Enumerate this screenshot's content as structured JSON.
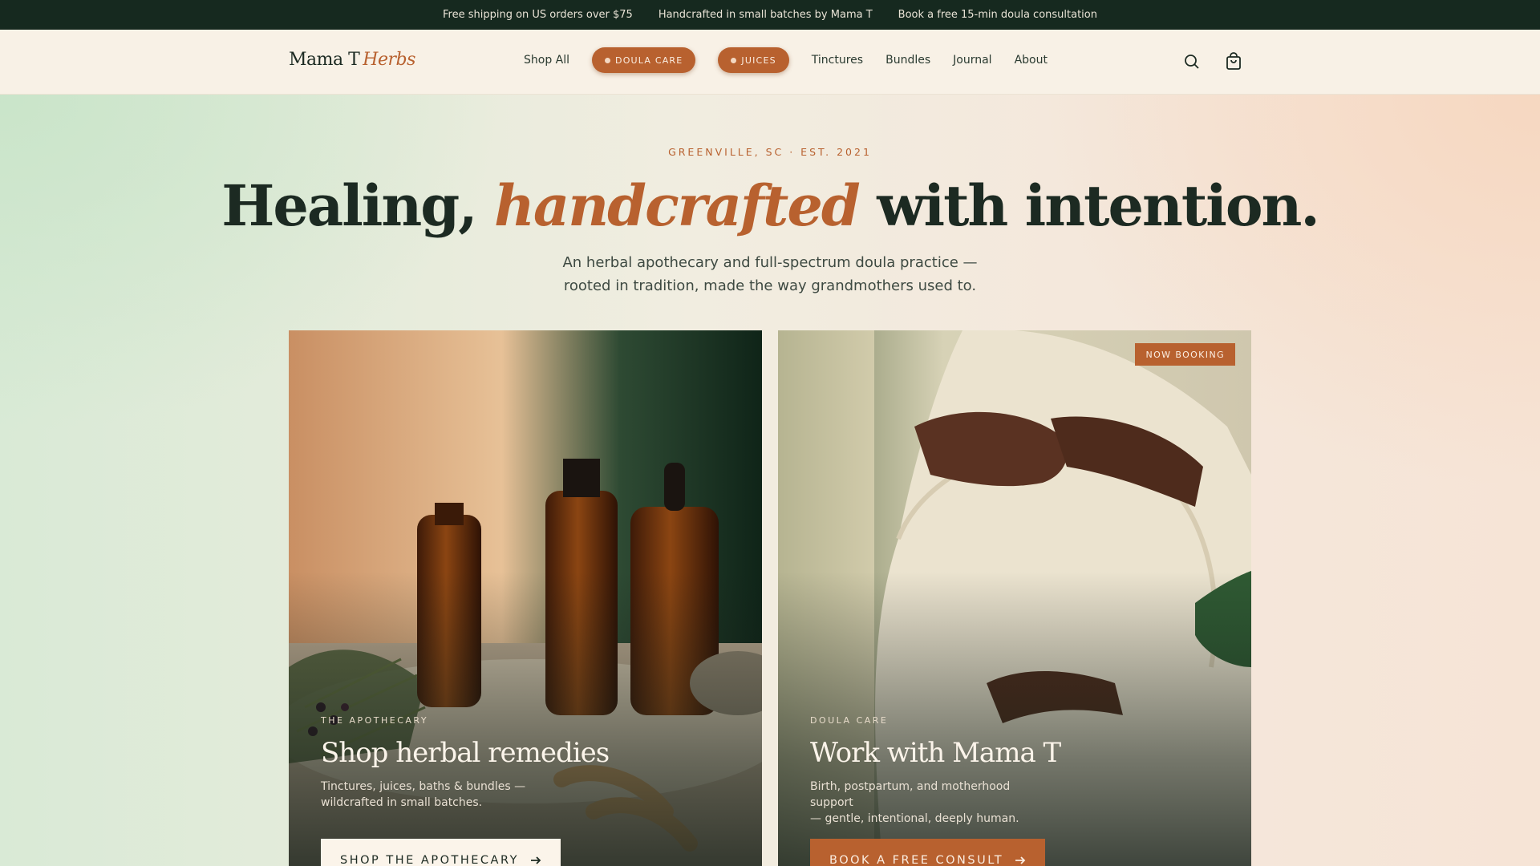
{
  "announcement": {
    "items": [
      "Free shipping on US orders over $75",
      "Handcrafted in small batches by Mama T",
      "Book a free 15-min doula consultation"
    ]
  },
  "header": {
    "logo_main": "Mama T",
    "logo_accent": "Herbs",
    "nav": {
      "shop_all": "Shop All",
      "doula_care": "DOULA CARE",
      "juices": "JUICES",
      "tinctures": "Tinctures",
      "bundles": "Bundles",
      "journal": "Journal",
      "about": "About"
    },
    "icons": {
      "search": "search-icon",
      "cart": "shopping-bag-icon"
    }
  },
  "hero": {
    "eyebrow": "GREENVILLE, SC · EST. 2021",
    "headline_part1": "Healing, ",
    "headline_em": "handcrafted",
    "headline_part2": " with intention.",
    "sub_line1": "An herbal apothecary and full-spectrum doula practice —",
    "sub_line2": "rooted in tradition, made the way grandmothers used to."
  },
  "cards": {
    "apothecary": {
      "eyebrow": "THE APOTHECARY",
      "title": "Shop herbal remedies",
      "desc_line1": "Tinctures, juices, baths & bundles —",
      "desc_line2": "wildcrafted in small batches.",
      "button": "SHOP THE APOTHECARY"
    },
    "doula": {
      "badge": "NOW BOOKING",
      "eyebrow": "DOULA CARE",
      "title": "Work with Mama T",
      "desc_line1": "Birth, postpartum, and motherhood support",
      "desc_line2": "— gentle, intentional, deeply human.",
      "button": "BOOK A FREE CONSULT"
    }
  },
  "colors": {
    "brand_dark": "#16291f",
    "accent": "#b8612f",
    "cream": "#f8f1e6"
  }
}
